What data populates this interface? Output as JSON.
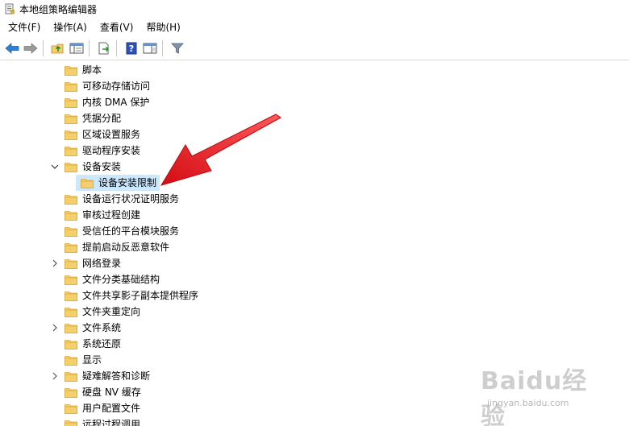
{
  "window": {
    "title": "本地组策略编辑器"
  },
  "menu": [
    "文件(F)",
    "操作(A)",
    "查看(V)",
    "帮助(H)"
  ],
  "toolbar": {
    "buttons": [
      "back-arrow-icon",
      "forward-arrow-icon",
      "up-folder-icon",
      "show-hide-tree-icon",
      "export-list-icon",
      "help-icon",
      "properties-pane-icon",
      "filter-icon"
    ]
  },
  "tree": {
    "items": [
      {
        "label": "脚本",
        "expander": "none"
      },
      {
        "label": "可移动存储访问",
        "expander": "none"
      },
      {
        "label": "内核 DMA 保护",
        "expander": "none"
      },
      {
        "label": "凭据分配",
        "expander": "none"
      },
      {
        "label": "区域设置服务",
        "expander": "none"
      },
      {
        "label": "驱动程序安装",
        "expander": "none"
      },
      {
        "label": "设备安装",
        "expander": "expanded"
      },
      {
        "label": "设备安装限制",
        "expander": "none",
        "selected": true,
        "child": true
      },
      {
        "label": "设备运行状况证明服务",
        "expander": "none"
      },
      {
        "label": "审核过程创建",
        "expander": "none"
      },
      {
        "label": "受信任的平台模块服务",
        "expander": "none"
      },
      {
        "label": "提前启动反恶意软件",
        "expander": "none"
      },
      {
        "label": "网络登录",
        "expander": "collapsed"
      },
      {
        "label": "文件分类基础结构",
        "expander": "none"
      },
      {
        "label": "文件共享影子副本提供程序",
        "expander": "none"
      },
      {
        "label": "文件夹重定向",
        "expander": "none"
      },
      {
        "label": "文件系统",
        "expander": "collapsed"
      },
      {
        "label": "系统还原",
        "expander": "none"
      },
      {
        "label": "显示",
        "expander": "none"
      },
      {
        "label": "疑难解答和诊断",
        "expander": "collapsed"
      },
      {
        "label": "硬盘 NV 缓存",
        "expander": "none"
      },
      {
        "label": "用户配置文件",
        "expander": "none"
      },
      {
        "label": "远程过程调用",
        "expander": "none"
      }
    ]
  },
  "colors": {
    "folder": "#f5cf6b",
    "folder_edge": "#d9a93c",
    "selection": "#cce8ff",
    "annotation_arrow": "#e8141e"
  },
  "watermark": {
    "brand": "Baidu经验",
    "url": "jingyan.baidu.com"
  }
}
